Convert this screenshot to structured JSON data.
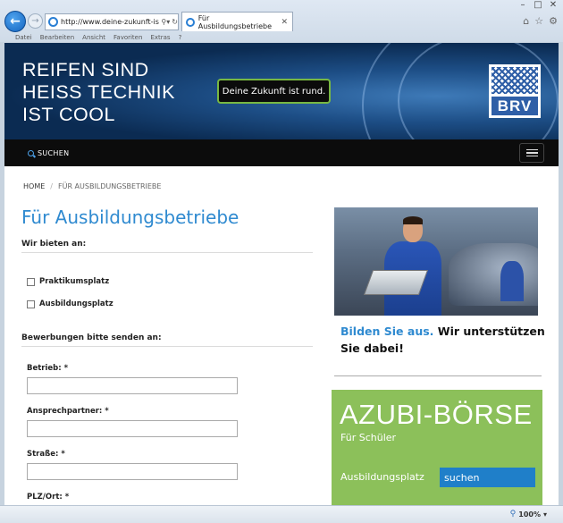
{
  "browser": {
    "url": "http://www.deine-zukunft-ist...",
    "tab_title": "Für Ausbildungsbetriebe",
    "menu": [
      "Datei",
      "Bearbeiten",
      "Ansicht",
      "Favoriten",
      "Extras",
      "?"
    ],
    "zoom": "100%"
  },
  "hero": {
    "title_lines": [
      "REIFEN SIND",
      "HEISS TECHNIK",
      "IST COOL"
    ],
    "slogan": "Deine Zukunft ist rund.",
    "logo_text": "BRV"
  },
  "nav": {
    "search_label": "SUCHEN"
  },
  "breadcrumb": {
    "home": "HOME",
    "separator": "/",
    "current": "FÜR AUSBILDUNGSBETRIEBE"
  },
  "main": {
    "title": "Für Ausbildungsbetriebe",
    "offer_heading": "Wir bieten an:",
    "offer_options": [
      "Praktikumsplatz",
      "Ausbildungsplatz"
    ],
    "send_heading": "Bewerbungen bitte senden an:",
    "fields": [
      {
        "label": "Betrieb: *",
        "value": ""
      },
      {
        "label": "Ansprechpartner: *",
        "value": ""
      },
      {
        "label": "Straße: *",
        "value": ""
      },
      {
        "label": "PLZ/Ort: *",
        "value": ""
      }
    ]
  },
  "sidebar": {
    "promo_highlight": "Bilden Sie aus.",
    "promo_rest": "Wir unterstützen Sie dabei!",
    "azubi_title": "AZUBI-BÖRSE",
    "azubi_subtitle": "Für Schüler",
    "azubi_label": "Ausbildungsplatz",
    "azubi_button": "suchen"
  },
  "colors": {
    "accent_blue": "#2f8ad0",
    "azubi_green": "#8cc05a",
    "slogan_border": "#78b843"
  }
}
